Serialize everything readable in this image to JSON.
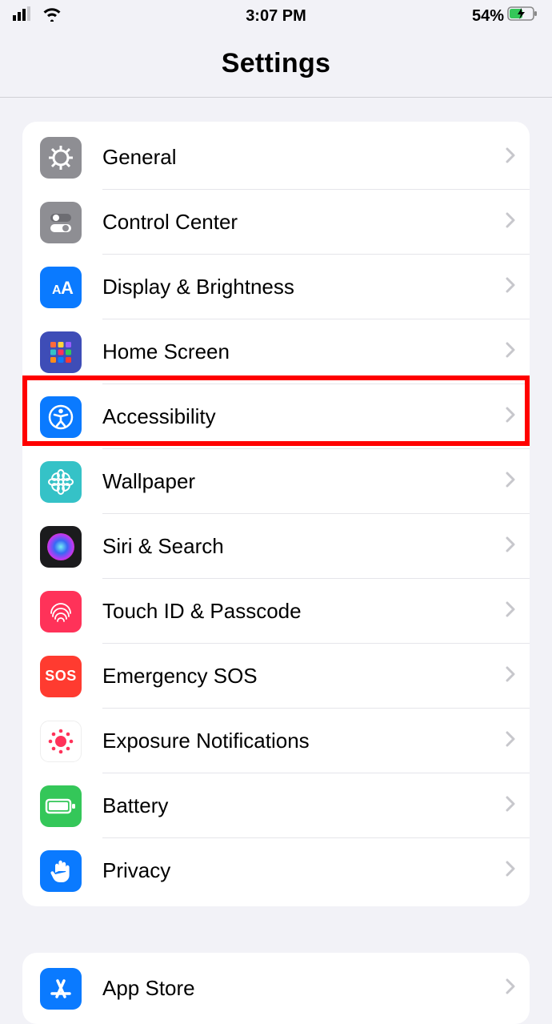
{
  "status": {
    "time": "3:07 PM",
    "battery_percent": "54%"
  },
  "header": {
    "title": "Settings"
  },
  "group1": {
    "items": [
      {
        "label": "General"
      },
      {
        "label": "Control Center"
      },
      {
        "label": "Display & Brightness"
      },
      {
        "label": "Home Screen"
      },
      {
        "label": "Accessibility"
      },
      {
        "label": "Wallpaper"
      },
      {
        "label": "Siri & Search"
      },
      {
        "label": "Touch ID & Passcode"
      },
      {
        "label": "Emergency SOS"
      },
      {
        "label": "Exposure Notifications"
      },
      {
        "label": "Battery"
      },
      {
        "label": "Privacy"
      }
    ]
  },
  "group2": {
    "items": [
      {
        "label": "App Store"
      }
    ]
  },
  "highlight": {
    "target_label": "Accessibility"
  }
}
